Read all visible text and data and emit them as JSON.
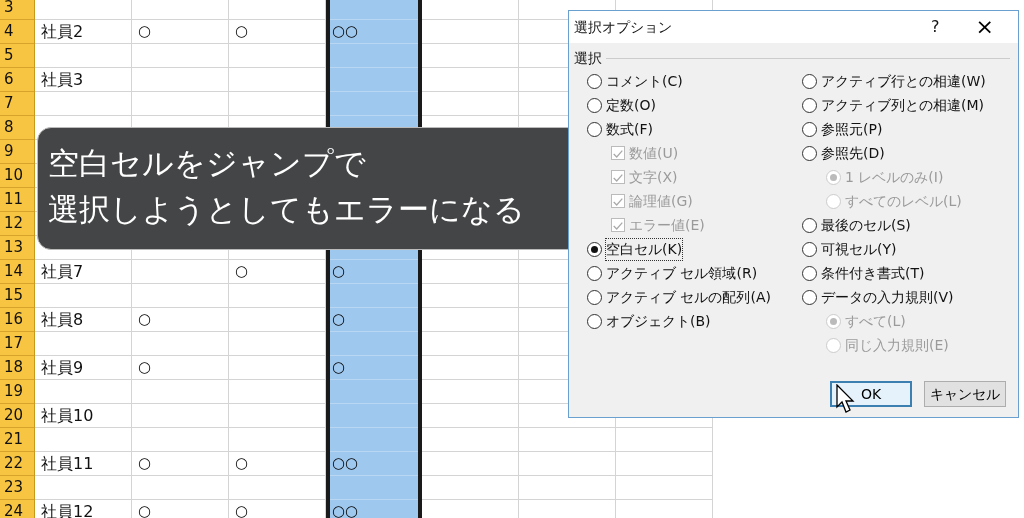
{
  "sheet": {
    "columns": [
      {
        "selected": false
      },
      {
        "selected": false
      },
      {
        "selected": false
      },
      {
        "selected": true
      },
      {
        "selected": false
      },
      {
        "selected": false
      },
      {
        "selected": false
      }
    ],
    "rows": [
      {
        "number": "3"
      },
      {
        "number": "4",
        "column_1": "社員2",
        "column_2": "○",
        "column_3": "○",
        "column_4": "○○"
      },
      {
        "number": "5"
      },
      {
        "number": "6",
        "column_1": "社員3"
      },
      {
        "number": "7"
      },
      {
        "number": "8"
      },
      {
        "number": "9"
      },
      {
        "number": "10"
      },
      {
        "number": "11"
      },
      {
        "number": "12"
      },
      {
        "number": "13"
      },
      {
        "number": "14",
        "column_1": "社員7",
        "column_3": "○",
        "column_4": "○"
      },
      {
        "number": "15"
      },
      {
        "number": "16",
        "column_1": "社員8",
        "column_2": "○",
        "column_4": "○"
      },
      {
        "number": "17"
      },
      {
        "number": "18",
        "column_1": "社員9",
        "column_2": "○",
        "column_4": "○"
      },
      {
        "number": "19"
      },
      {
        "number": "20",
        "column_1": "社員10"
      },
      {
        "number": "21"
      },
      {
        "number": "22",
        "column_1": "社員11",
        "column_2": "○",
        "column_3": "○",
        "column_4": "○○"
      },
      {
        "number": "23"
      },
      {
        "number": "24",
        "column_1": "社員12",
        "column_2": "○",
        "column_3": "○",
        "column_4": "○○"
      }
    ]
  },
  "caption": {
    "lines": [
      "空白セルをジャンプで",
      "選択しようとしてもエラーになる"
    ]
  },
  "dialog": {
    "title": "選択オプション",
    "help": "?",
    "close": "×",
    "group": "選択",
    "left_options": [
      {
        "kind": "radio",
        "label": "コメント(C)",
        "selected": false,
        "disabled": false,
        "focused": false
      },
      {
        "kind": "radio",
        "label": "定数(O)",
        "selected": false,
        "disabled": false,
        "focused": false
      },
      {
        "kind": "radio",
        "label": "数式(F)",
        "selected": false,
        "disabled": false,
        "focused": false,
        "children": [
          {
            "kind": "checkbox",
            "label": "数値(U)",
            "checked": true,
            "disabled": true
          },
          {
            "kind": "checkbox",
            "label": "文字(X)",
            "checked": true,
            "disabled": true
          },
          {
            "kind": "checkbox",
            "label": "論理値(G)",
            "checked": true,
            "disabled": true
          },
          {
            "kind": "checkbox",
            "label": "エラー値(E)",
            "checked": true,
            "disabled": true
          }
        ]
      },
      {
        "kind": "radio",
        "label": "空白セル(K)",
        "selected": true,
        "disabled": false,
        "focused": true
      },
      {
        "kind": "radio",
        "label": "アクティブ セル領域(R)",
        "selected": false,
        "disabled": false,
        "focused": false
      },
      {
        "kind": "radio",
        "label": "アクティブ セルの配列(A)",
        "selected": false,
        "disabled": false,
        "focused": false
      },
      {
        "kind": "radio",
        "label": "オブジェクト(B)",
        "selected": false,
        "disabled": false,
        "focused": false
      }
    ],
    "right_options": [
      {
        "kind": "radio",
        "label": "アクティブ行との相違(W)",
        "selected": false,
        "disabled": false,
        "focused": false
      },
      {
        "kind": "radio",
        "label": "アクティブ列との相違(M)",
        "selected": false,
        "disabled": false,
        "focused": false
      },
      {
        "kind": "radio",
        "label": "参照元(P)",
        "selected": false,
        "disabled": false,
        "focused": false
      },
      {
        "kind": "radio",
        "label": "参照先(D)",
        "selected": false,
        "disabled": false,
        "focused": false,
        "children": [
          {
            "kind": "radio",
            "label": "1 レベルのみ(I)",
            "selected": true,
            "disabled": true,
            "focused": false
          },
          {
            "kind": "radio",
            "label": "すべてのレベル(L)",
            "selected": false,
            "disabled": true,
            "focused": false
          }
        ]
      },
      {
        "kind": "radio",
        "label": "最後のセル(S)",
        "selected": false,
        "disabled": false,
        "focused": false
      },
      {
        "kind": "radio",
        "label": "可視セル(Y)",
        "selected": false,
        "disabled": false,
        "focused": false
      },
      {
        "kind": "radio",
        "label": "条件付き書式(T)",
        "selected": false,
        "disabled": false,
        "focused": false
      },
      {
        "kind": "radio",
        "label": "データの入力規則(V)",
        "selected": false,
        "disabled": false,
        "focused": false,
        "children": [
          {
            "kind": "radio",
            "label": "すべて(L)",
            "selected": true,
            "disabled": true,
            "focused": false
          },
          {
            "kind": "radio",
            "label": "同じ入力規則(E)",
            "selected": false,
            "disabled": true,
            "focused": false
          }
        ]
      }
    ],
    "buttons": [
      {
        "label": "OK",
        "default": true
      },
      {
        "label": "キャンセル",
        "default": false
      }
    ]
  }
}
